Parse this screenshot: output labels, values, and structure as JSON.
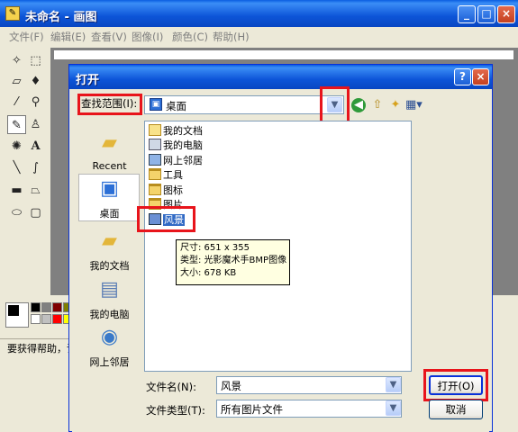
{
  "paint": {
    "title": "未命名 - 画图",
    "menu": [
      "文件(F)",
      "编辑(E)",
      "查看(V)",
      "图像(I)",
      "颜色(C)",
      "帮助(H)"
    ],
    "status": "要获得帮助，请"
  },
  "dialog": {
    "title": "打开",
    "help_btn": "?",
    "close_btn": "×",
    "look_in_label": "查找范围(I):",
    "look_in_value": "桌面",
    "places": [
      {
        "label": "Recent",
        "icon": "recent-folder-icon"
      },
      {
        "label": "桌面",
        "icon": "desktop-icon"
      },
      {
        "label": "我的文档",
        "icon": "my-documents-icon"
      },
      {
        "label": "我的电脑",
        "icon": "my-computer-icon"
      },
      {
        "label": "网上邻居",
        "icon": "network-places-icon"
      }
    ],
    "files": [
      {
        "name": "我的文档",
        "icon": "my-documents-icon"
      },
      {
        "name": "我的电脑",
        "icon": "my-computer-icon"
      },
      {
        "name": "网上邻居",
        "icon": "network-places-icon"
      },
      {
        "name": "工具",
        "icon": "folder-icon"
      },
      {
        "name": "图标",
        "icon": "folder-icon"
      },
      {
        "name": "图片",
        "icon": "folder-icon"
      },
      {
        "name": "风景",
        "icon": "bmp-file-icon",
        "selected": true
      }
    ],
    "tooltip": {
      "size": "尺寸: 651 x 355",
      "type": "类型: 光影魔术手BMP图像",
      "filesize": "大小: 678 KB"
    },
    "file_name_label": "文件名(N):",
    "file_name_value": "风景",
    "file_type_label": "文件类型(T):",
    "file_type_value": "所有图片文件",
    "open_button": "打开(O)",
    "cancel_button": "取消"
  },
  "colors": {
    "title_bar": "#0a5de1",
    "highlight": "#e8141b",
    "selection": "#316ac5"
  }
}
